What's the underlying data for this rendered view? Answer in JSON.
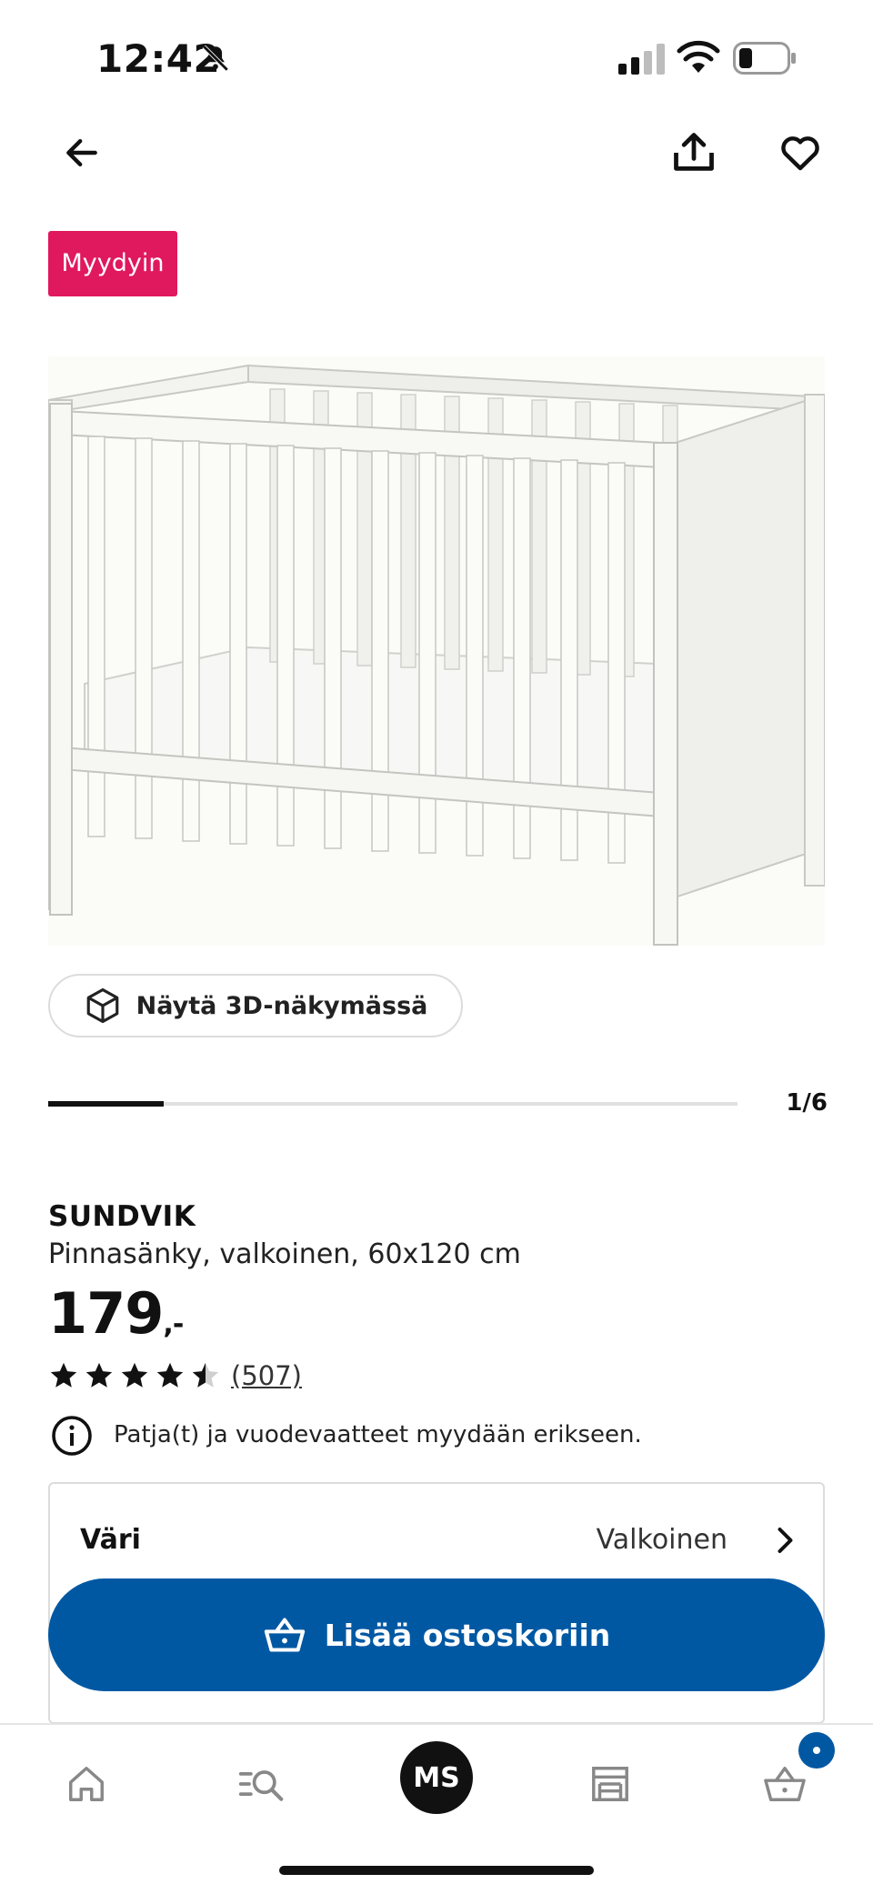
{
  "status_bar": {
    "time": "12:42"
  },
  "badge": "Myydyin",
  "view_3d_label": "Näytä 3D-näkymässä",
  "carousel": {
    "counter": "1/6",
    "progress": 0.167
  },
  "product": {
    "brand": "SUNDVIK",
    "description": "Pinnasänky, valkoinen, 60x120 cm",
    "price": "179",
    "price_suffix": ",-",
    "rating": 4.5,
    "review_count": "(507)",
    "notice": "Patja(t) ja vuodevaatteet myydään erikseen."
  },
  "color_selector": {
    "label": "Väri",
    "value": "Valkoinen"
  },
  "add_to_cart_label": "Lisää ostoskoriin",
  "nav": {
    "avatar_initials": "MS"
  },
  "colors": {
    "accent_blue": "#0058a3",
    "badge_pink": "#e0185d"
  }
}
